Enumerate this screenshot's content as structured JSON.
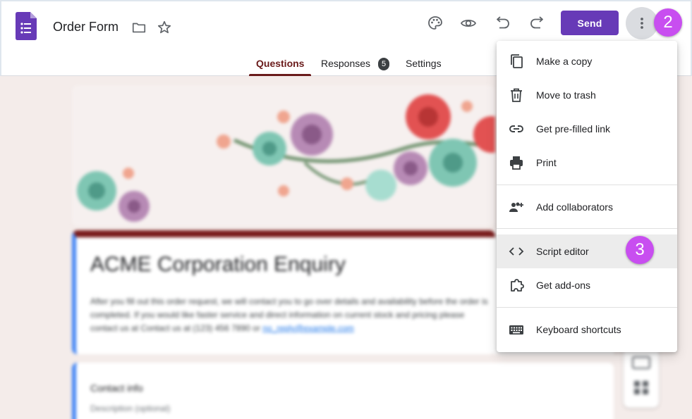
{
  "header": {
    "form_title": "Order Form",
    "send_label": "Send",
    "tabs": {
      "questions": "Questions",
      "responses": "Responses",
      "responses_count": "5",
      "settings": "Settings"
    }
  },
  "badges": {
    "step_2": "2",
    "step_3": "3"
  },
  "form": {
    "heading": "ACME Corporation Enquiry",
    "description": "After you fill out this order request, we will contact you to go over details and availability before the order is completed. If you would like faster service and direct information on current stock and pricing please contact us at Contact us at (123) 456 7890 or",
    "email": "no_reply@example.com",
    "question_title": "Contact info",
    "question_desc": "Description (optional)"
  },
  "menu": {
    "items": [
      {
        "label": "Make a copy",
        "icon": "copy-icon"
      },
      {
        "label": "Move to trash",
        "icon": "trash-icon"
      },
      {
        "label": "Get pre-filled link",
        "icon": "link-icon"
      },
      {
        "label": "Print",
        "icon": "print-icon"
      },
      {
        "label": "Add collaborators",
        "icon": "add-people-icon"
      },
      {
        "label": "Script editor",
        "icon": "code-icon"
      },
      {
        "label": "Get add-ons",
        "icon": "puzzle-icon"
      },
      {
        "label": "Keyboard shortcuts",
        "icon": "keyboard-icon"
      }
    ]
  },
  "colors": {
    "accent": "#673ab7",
    "badge": "#c84ef0",
    "tab_active": "#6a1b1b",
    "card_border": "#4285f4"
  }
}
